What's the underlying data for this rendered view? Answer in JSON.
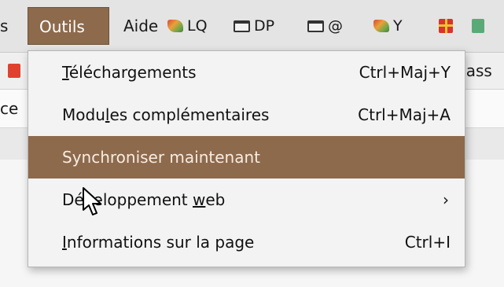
{
  "menubar": {
    "partial_left": "s",
    "outils": "Outils",
    "aide": "Aide"
  },
  "bookmarks": [
    {
      "icon": "leaf-icon",
      "label": "LQ"
    },
    {
      "icon": "folder-icon",
      "label": "DP"
    },
    {
      "icon": "folder-icon",
      "label": "@"
    },
    {
      "icon": "leaf-icon",
      "label": "Y"
    },
    {
      "icon": "gift-icon",
      "label": ""
    },
    {
      "icon": "tile-icon",
      "label": ""
    }
  ],
  "toolbar2": {
    "right_text": "pass"
  },
  "row3": {
    "left_text": "ce"
  },
  "dropdown": {
    "items": [
      {
        "label": "Téléchargements",
        "shortcut": "Ctrl+Maj+Y"
      },
      {
        "label": "Modules complémentaires",
        "shortcut": "Ctrl+Maj+A"
      },
      {
        "label": "Synchroniser maintenant",
        "shortcut": ""
      },
      {
        "label": "Développement web",
        "shortcut": "›"
      },
      {
        "label": "Informations sur la page",
        "shortcut": "Ctrl+I"
      }
    ]
  },
  "colors": {
    "accent": "#8d6a4c",
    "menubar_bg": "#e4e4e4",
    "menu_bg": "#f3f3f3"
  }
}
